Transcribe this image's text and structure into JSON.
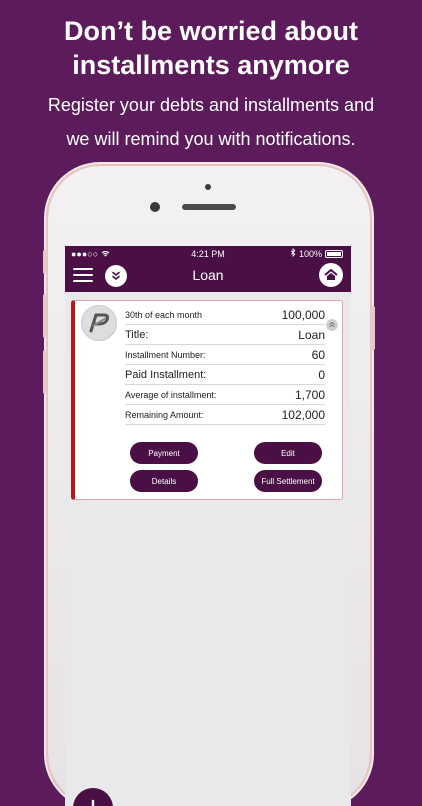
{
  "headline": {
    "line1": "Don’t be worried about",
    "line2": "installments anymore"
  },
  "subtitle": {
    "line1": "Register your debts and installments and",
    "line2": "we will remind you with notifications."
  },
  "status_bar": {
    "signal": "●●●○○",
    "time": "4:21 PM",
    "battery": "100%"
  },
  "nav": {
    "title": "Loan",
    "icons": [
      "menu-icon",
      "chevron-down-icon",
      "home-icon"
    ]
  },
  "loan_card": {
    "due_label": "30th of each month",
    "amount": "100,000",
    "rows": [
      {
        "label": "Title:",
        "value": "Loan"
      },
      {
        "label": "Installment Number:",
        "value": "60"
      },
      {
        "label": "Paid Installment:",
        "value": "0"
      },
      {
        "label": "Average of installment:",
        "value": "1,700"
      },
      {
        "label": "Remaining Amount:",
        "value": "102,000"
      }
    ],
    "buttons": {
      "payment": "Payment",
      "edit": "Edit",
      "details": "Details",
      "full_settlement": "Full Settlement"
    }
  },
  "fab_icon": "plus-icon",
  "colors": {
    "background": "#5c1c5c",
    "navbar": "#4a0f45",
    "card_accent": "#b01c1c",
    "button": "#4a0f45"
  }
}
